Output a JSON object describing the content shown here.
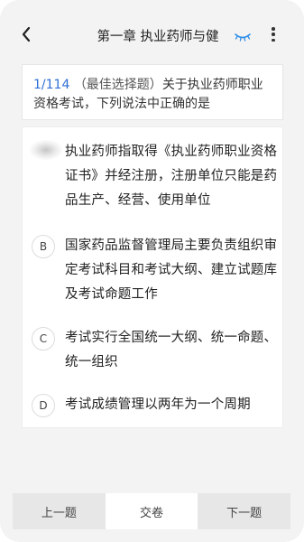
{
  "header": {
    "title": "第一章 执业药师与健",
    "icons": [
      "back-icon",
      "eye-icon",
      "more-icon"
    ]
  },
  "question": {
    "number": "1/114",
    "type": "（最佳选择题）",
    "text_line1": "关于执业药师职业",
    "text_line2": "资格考试，下列说法中正确的是"
  },
  "options": [
    {
      "letter": "A",
      "lines": [
        "执业药师指取得《执业药师职业资格",
        "证书》并经注册，注册单位只能是药",
        "品生产、经营、使用单位"
      ]
    },
    {
      "letter": "B",
      "lines": [
        "国家药品监督管理局主要负责组织审",
        "定考试科目和考试大纲、建立试题库",
        "及考试命题工作"
      ]
    },
    {
      "letter": "C",
      "lines": [
        "考试实行全国统一大纲、统一命题、",
        "统一组织"
      ]
    },
    {
      "letter": "D",
      "lines": [
        "考试成绩管理以两年为一个周期"
      ]
    }
  ],
  "bottom": {
    "prev_label": "上一题",
    "submit_label": "交卷",
    "next_label": "下一题"
  },
  "colors": {
    "accent": "#2f6fd6",
    "background": "#f3f3f3"
  }
}
